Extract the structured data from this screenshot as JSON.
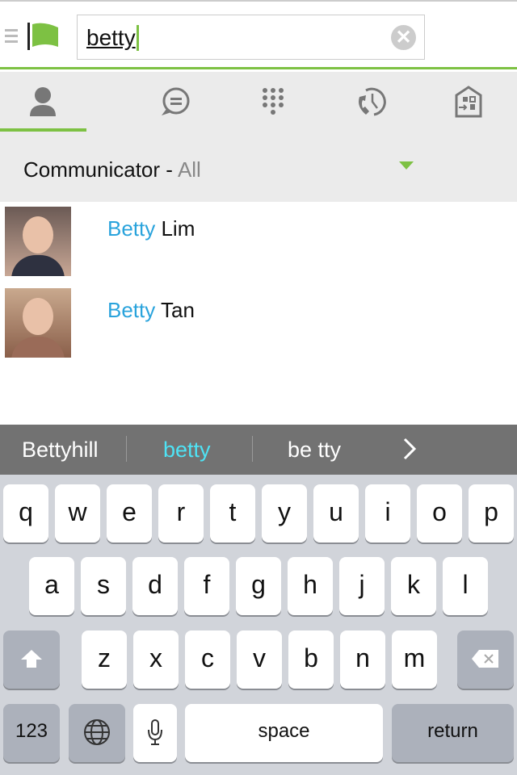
{
  "search": {
    "value": "betty"
  },
  "tabs": [
    {
      "icon": "contact-icon",
      "active": true
    },
    {
      "icon": "chat-icon"
    },
    {
      "icon": "dialpad-icon"
    },
    {
      "icon": "call-history-icon"
    },
    {
      "icon": "transfer-icon"
    }
  ],
  "filter": {
    "label": "Communicator -",
    "value": "All"
  },
  "contacts": [
    {
      "match": "Betty",
      "rest": " Lim"
    },
    {
      "match": "Betty",
      "rest": " Tan"
    }
  ],
  "suggestions": [
    "Bettyhill",
    "betty",
    "be tty"
  ],
  "keyboard": {
    "row1": [
      "q",
      "w",
      "e",
      "r",
      "t",
      "y",
      "u",
      "i",
      "o",
      "p"
    ],
    "row2": [
      "a",
      "s",
      "d",
      "f",
      "g",
      "h",
      "j",
      "k",
      "l"
    ],
    "row3": [
      "z",
      "x",
      "c",
      "v",
      "b",
      "n",
      "m"
    ],
    "numbers": "123",
    "space": "space",
    "return": "return"
  },
  "colors": {
    "accent": "#7dc143",
    "highlight": "#29a3dc",
    "suggestion_active": "#4ee3f5"
  }
}
